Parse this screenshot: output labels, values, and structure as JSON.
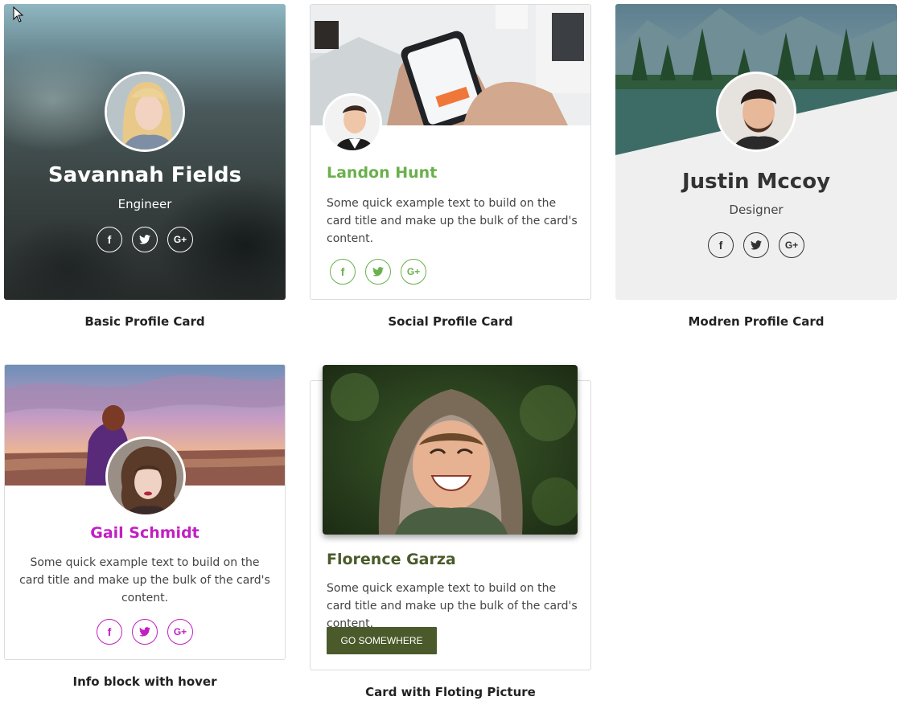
{
  "cards": [
    {
      "name": "Savannah Fields",
      "role": "Engineer",
      "caption": "Basic Profile Card"
    },
    {
      "name": "Landon Hunt",
      "text": "Some quick example text to build on the card title and make up the bulk of the card's content.",
      "caption": "Social Profile Card",
      "accent": "#6ab04c"
    },
    {
      "name": "Justin Mccoy",
      "role": "Designer",
      "caption": "Modren Profile Card"
    },
    {
      "name": "Gail Schmidt",
      "text": "Some quick example text to build on the card title and make up the bulk of the card's content.",
      "caption": "Info block with hover",
      "accent": "#c21fc2"
    },
    {
      "name": "Florence Garza",
      "text": "Some quick example text to build on the card title and make up the bulk of the card's content.",
      "button": "GO SOMEWHERE",
      "caption": "Card with Floting Picture",
      "accent": "#4a5a2a"
    }
  ],
  "social_icons": {
    "facebook": "f",
    "google_plus": "G+"
  }
}
